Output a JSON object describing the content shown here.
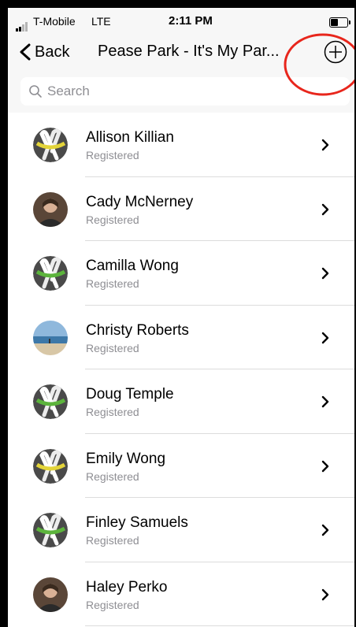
{
  "status_bar": {
    "carrier": "T-Mobile",
    "network": "LTE",
    "time": "2:11 PM"
  },
  "nav": {
    "back_label": "Back",
    "title": "Pease Park - It's My Par...",
    "add_icon": "plus-circle-icon"
  },
  "search": {
    "placeholder": "Search",
    "value": ""
  },
  "colors": {
    "annotation_circle": "#e8261c",
    "ribbon_yellow": "#e3d43a",
    "ribbon_green": "#5cb43c",
    "avatar_dark": "#4a4a4a",
    "secondary_text": "#8e8e93"
  },
  "members": [
    {
      "name": "Allison Killian",
      "status": "Registered",
      "avatar": "ribbon-yellow"
    },
    {
      "name": "Cady McNerney",
      "status": "Registered",
      "avatar": "photo"
    },
    {
      "name": "Camilla Wong",
      "status": "Registered",
      "avatar": "ribbon-green"
    },
    {
      "name": "Christy Roberts",
      "status": "Registered",
      "avatar": "beach-photo"
    },
    {
      "name": "Doug Temple",
      "status": "Registered",
      "avatar": "ribbon-green"
    },
    {
      "name": "Emily Wong",
      "status": "Registered",
      "avatar": "ribbon-yellow"
    },
    {
      "name": "Finley Samuels",
      "status": "Registered",
      "avatar": "ribbon-green"
    },
    {
      "name": "Haley Perko",
      "status": "Registered",
      "avatar": "photo"
    }
  ]
}
